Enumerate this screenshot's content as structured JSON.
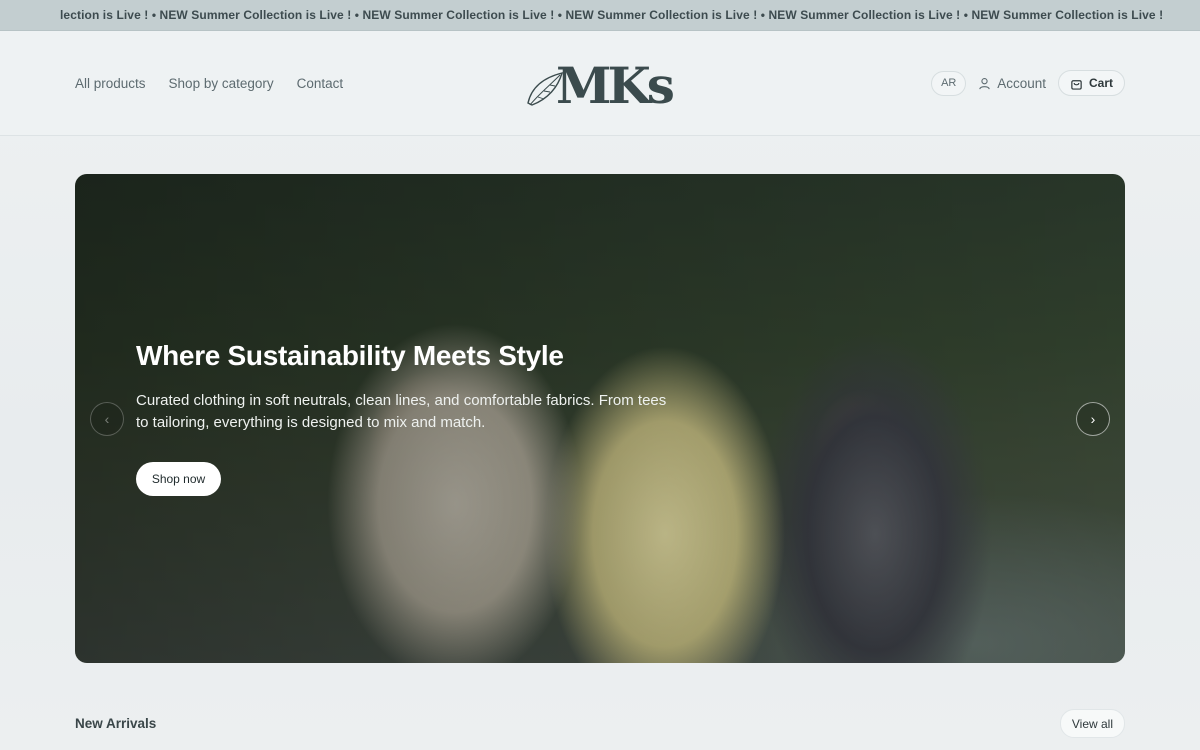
{
  "announcement": {
    "text": "lection is Live ! • NEW Summer Collection is Live ! • NEW Summer Collection is Live ! • NEW Summer Collection is Live ! • NEW Summer Collection is Live ! • NEW Summer Collection is Live !"
  },
  "header": {
    "nav": [
      "All products",
      "Shop by category",
      "Contact"
    ],
    "logo_text": "MKs",
    "lang_label": "AR",
    "account_label": "Account",
    "cart_label": "Cart"
  },
  "hero": {
    "title": "Where Sustainability Meets Style",
    "description": "Curated clothing in soft neutrals, clean lines, and comfortable fabrics. From tees to tailoring, everything is designed to mix and match.",
    "cta_label": "Shop now",
    "prev_icon": "chevron-left-icon",
    "next_icon": "chevron-right-icon"
  },
  "new_arrivals": {
    "title": "New Arrivals",
    "view_all_label": "View all"
  },
  "colors": {
    "announcement_bg": "#c3ced0",
    "header_bg": "#eef2f3",
    "text_muted": "#5d6b70",
    "logo": "#3b4b4d"
  }
}
